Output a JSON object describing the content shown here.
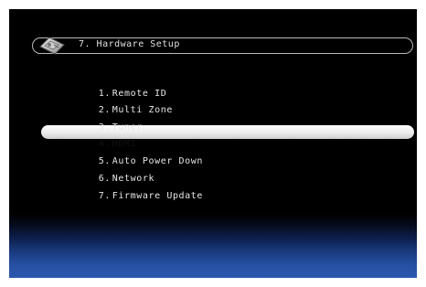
{
  "header": {
    "title": "7. Hardware Setup",
    "icon": "wrench-tool-icon"
  },
  "menu": {
    "selected_index": 3,
    "items": [
      {
        "number": "1.",
        "label": "Remote ID"
      },
      {
        "number": "2.",
        "label": "Multi Zone"
      },
      {
        "number": "3.",
        "label": "Tuner"
      },
      {
        "number": "4.",
        "label": "HDMI"
      },
      {
        "number": "5.",
        "label": "Auto Power Down"
      },
      {
        "number": "6.",
        "label": "Network"
      },
      {
        "number": "7.",
        "label": "Firmware Update"
      }
    ]
  },
  "colors": {
    "background": "#000000",
    "bottom_gradient": "#2a58ad",
    "text": "#e6e6e6",
    "highlight": "#f0f0f0"
  }
}
